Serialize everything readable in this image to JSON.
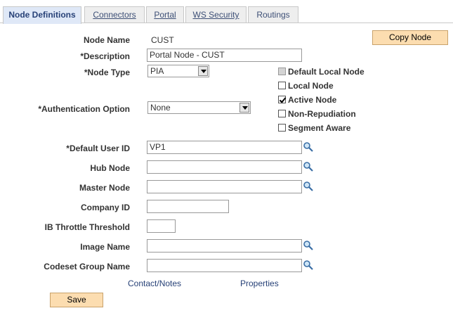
{
  "tabs": [
    {
      "label": "Node Definitions",
      "mnemonic": "",
      "rest": "",
      "active": true
    },
    {
      "label": "",
      "mnemonic": "C",
      "rest": "onnectors",
      "active": false
    },
    {
      "label": "",
      "mnemonic": "P",
      "rest": "ortal",
      "active": false
    },
    {
      "label": "",
      "mnemonic": "W",
      "rest": "S Security",
      "active": false
    },
    {
      "label": "Routings",
      "mnemonic": "",
      "rest": "",
      "active": false
    }
  ],
  "form": {
    "node_name_label": "Node Name",
    "node_name_value": "CUST",
    "description_label": "*Description",
    "description_value": "Portal Node - CUST",
    "node_type_label": "*Node Type",
    "node_type_value": "PIA",
    "auth_label": "*Authentication Option",
    "auth_value": "None",
    "default_user_label": "*Default User ID",
    "default_user_value": "VP1",
    "hub_node_label": "Hub Node",
    "hub_node_value": "",
    "master_node_label": "Master Node",
    "master_node_value": "",
    "company_id_label": "Company ID",
    "company_id_value": "",
    "throttle_label": "IB Throttle Threshold",
    "throttle_value": "",
    "image_name_label": "Image Name",
    "image_name_value": "",
    "codeset_label": "Codeset Group Name",
    "codeset_value": ""
  },
  "checkboxes": {
    "default_local": {
      "label": "Default Local Node",
      "checked": false,
      "disabled": true
    },
    "local": {
      "label": "Local Node",
      "checked": false,
      "disabled": false
    },
    "active": {
      "label": "Active Node",
      "checked": true,
      "disabled": false
    },
    "non_repudiation": {
      "label": "Non-Repudiation",
      "checked": false,
      "disabled": false
    },
    "segment_aware": {
      "label": "Segment Aware",
      "checked": false,
      "disabled": false
    }
  },
  "buttons": {
    "copy_node": "Copy Node",
    "save": "Save"
  },
  "links": {
    "contact_notes": "Contact/Notes",
    "properties": "Properties"
  },
  "colors": {
    "tab_active_bg": "#dfe8f7",
    "tab_text": "#3d4f76",
    "button_bg": "#fcddb0",
    "link": "#274177"
  },
  "icons": {
    "lookup": "magnifier-lookup-icon",
    "dropdown": "chevron-down-icon",
    "check": "checkmark-icon"
  }
}
